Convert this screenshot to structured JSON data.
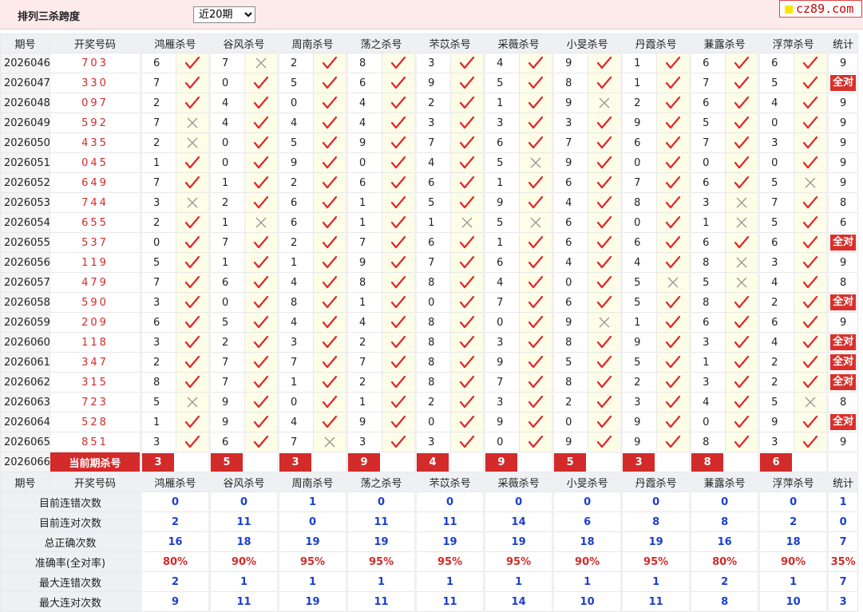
{
  "title": "排列三杀跨度",
  "period_select": {
    "value": "近20期",
    "options": [
      "近20期"
    ]
  },
  "logo_text": "cz89.com",
  "headers": {
    "period": "期号",
    "draw": "开奖号码",
    "experts": [
      "鸿雁杀号",
      "谷风杀号",
      "周南杀号",
      "荡之杀号",
      "芣苡杀号",
      "采薇杀号",
      "小旻杀号",
      "丹霞杀号",
      "蒹露杀号",
      "浮萍杀号"
    ],
    "stat": "统计"
  },
  "full_label": "全对",
  "rows": [
    {
      "period": "2026046",
      "draw": "703",
      "kills": [
        6,
        7,
        2,
        8,
        3,
        4,
        9,
        1,
        6,
        6
      ],
      "marks": "ckcccccccc",
      "stat": "9"
    },
    {
      "period": "2026047",
      "draw": "330",
      "kills": [
        7,
        0,
        5,
        6,
        9,
        5,
        8,
        1,
        7,
        5
      ],
      "marks": "cccccccccc",
      "stat": "全对"
    },
    {
      "period": "2026048",
      "draw": "097",
      "kills": [
        2,
        4,
        0,
        4,
        2,
        1,
        9,
        2,
        6,
        4
      ],
      "marks": "ccccccxccc",
      "stat": "9"
    },
    {
      "period": "2026049",
      "draw": "592",
      "kills": [
        7,
        4,
        4,
        4,
        3,
        3,
        3,
        9,
        5,
        0
      ],
      "marks": "xccccccccc",
      "stat": "9"
    },
    {
      "period": "2026050",
      "draw": "435",
      "kills": [
        2,
        0,
        5,
        9,
        7,
        6,
        7,
        6,
        7,
        3
      ],
      "marks": "xccccccccc",
      "stat": "9"
    },
    {
      "period": "2026051",
      "draw": "045",
      "kills": [
        1,
        0,
        9,
        0,
        4,
        5,
        9,
        0,
        0,
        0
      ],
      "marks": "cccccxcccc",
      "stat": "9"
    },
    {
      "period": "2026052",
      "draw": "649",
      "kills": [
        7,
        1,
        2,
        6,
        6,
        1,
        6,
        7,
        6,
        5
      ],
      "marks": "cccccccccx",
      "stat": "9"
    },
    {
      "period": "2026053",
      "draw": "744",
      "kills": [
        3,
        2,
        6,
        1,
        5,
        9,
        4,
        8,
        3,
        7
      ],
      "marks": "xcccccccxc",
      "stat": "8"
    },
    {
      "period": "2026054",
      "draw": "655",
      "kills": [
        2,
        1,
        6,
        1,
        1,
        5,
        6,
        0,
        1,
        5
      ],
      "marks": "cxccxxccxc",
      "stat": "6"
    },
    {
      "period": "2026055",
      "draw": "537",
      "kills": [
        0,
        7,
        2,
        7,
        6,
        1,
        6,
        6,
        6,
        6
      ],
      "marks": "cccccccccc",
      "stat": "全对"
    },
    {
      "period": "2026056",
      "draw": "119",
      "kills": [
        5,
        1,
        1,
        9,
        7,
        6,
        4,
        4,
        8,
        3
      ],
      "marks": "ccccccccxc",
      "stat": "9"
    },
    {
      "period": "2026057",
      "draw": "479",
      "kills": [
        7,
        6,
        4,
        8,
        8,
        4,
        0,
        5,
        5,
        4
      ],
      "marks": "cccccccxxc",
      "stat": "8"
    },
    {
      "period": "2026058",
      "draw": "590",
      "kills": [
        3,
        0,
        8,
        1,
        0,
        7,
        6,
        5,
        8,
        2
      ],
      "marks": "cccccccccc",
      "stat": "全对"
    },
    {
      "period": "2026059",
      "draw": "209",
      "kills": [
        6,
        5,
        4,
        4,
        8,
        0,
        9,
        1,
        6,
        6
      ],
      "marks": "ccccccxccc",
      "stat": "9"
    },
    {
      "period": "2026060",
      "draw": "118",
      "kills": [
        3,
        2,
        3,
        2,
        8,
        3,
        8,
        9,
        3,
        4
      ],
      "marks": "cccccccccc",
      "stat": "全对"
    },
    {
      "period": "2026061",
      "draw": "347",
      "kills": [
        2,
        7,
        7,
        7,
        8,
        9,
        5,
        5,
        1,
        2
      ],
      "marks": "cccccccccc",
      "stat": "全对"
    },
    {
      "period": "2026062",
      "draw": "315",
      "kills": [
        8,
        7,
        1,
        2,
        8,
        7,
        8,
        2,
        3,
        2
      ],
      "marks": "cccccccccc",
      "stat": "全对"
    },
    {
      "period": "2026063",
      "draw": "723",
      "kills": [
        5,
        9,
        0,
        1,
        2,
        3,
        2,
        3,
        4,
        5
      ],
      "marks": "xccccccccx",
      "stat": "8"
    },
    {
      "period": "2026064",
      "draw": "528",
      "kills": [
        1,
        9,
        4,
        9,
        0,
        9,
        0,
        9,
        0,
        9
      ],
      "marks": "cccccccccc",
      "stat": "全对"
    },
    {
      "period": "2026065",
      "draw": "851",
      "kills": [
        3,
        6,
        7,
        3,
        3,
        0,
        9,
        9,
        8,
        3
      ],
      "marks": "ccxccccccc",
      "stat": "9"
    }
  ],
  "current": {
    "period": "2026066",
    "label": "当前期杀号",
    "kills": [
      "3",
      "5",
      "3",
      "9",
      "4",
      "9",
      "5",
      "3",
      "8",
      "6"
    ]
  },
  "summary": [
    {
      "label": "目前连错次数",
      "values": [
        "0",
        "0",
        "1",
        "0",
        "0",
        "0",
        "0",
        "0",
        "0",
        "0",
        "1"
      ],
      "pct": false
    },
    {
      "label": "目前连对次数",
      "values": [
        "2",
        "11",
        "0",
        "11",
        "11",
        "14",
        "6",
        "8",
        "8",
        "2",
        "0"
      ],
      "pct": false
    },
    {
      "label": "总正确次数",
      "values": [
        "16",
        "18",
        "19",
        "19",
        "19",
        "19",
        "18",
        "19",
        "16",
        "18",
        "7"
      ],
      "pct": false
    },
    {
      "label": "准确率(全对率)",
      "values": [
        "80%",
        "90%",
        "95%",
        "95%",
        "95%",
        "95%",
        "90%",
        "95%",
        "80%",
        "90%",
        "35%"
      ],
      "pct": true
    },
    {
      "label": "最大连错次数",
      "values": [
        "2",
        "1",
        "1",
        "1",
        "1",
        "1",
        "1",
        "1",
        "2",
        "1",
        "7"
      ],
      "pct": false
    },
    {
      "label": "最大连对次数",
      "values": [
        "9",
        "11",
        "19",
        "11",
        "11",
        "14",
        "10",
        "11",
        "8",
        "10",
        "3"
      ],
      "pct": false
    }
  ],
  "colors": {
    "accent": "#d32a2a",
    "summary_blue": "#1a3fd1",
    "check": "#e0262b",
    "cross": "#9a9a9a",
    "mark_bg": "#fdfde8"
  }
}
